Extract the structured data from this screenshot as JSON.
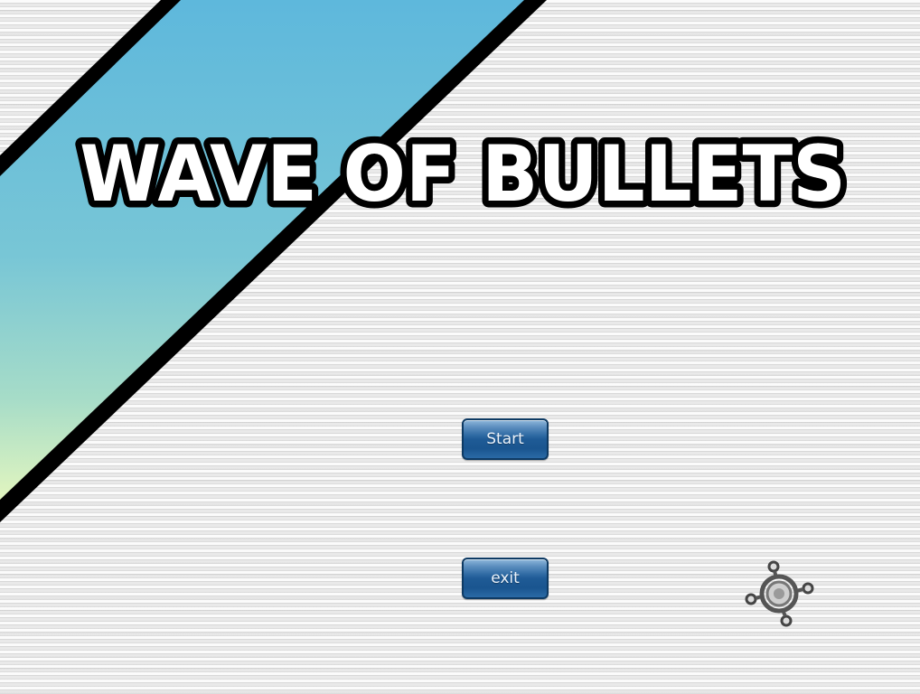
{
  "title": "WAVE OF BULLETS",
  "menu": {
    "start_label": "Start",
    "exit_label": "exit"
  },
  "colors": {
    "band_top": "#5eb8dc",
    "band_mid": "#7fcbd6",
    "band_bottom": "#e6f7c0",
    "band_outline": "#000000",
    "button_blue": "#1f5b96",
    "button_border": "#0e3a63",
    "title_fill": "#ffffff",
    "title_outline": "#000000"
  },
  "icons": {
    "player": "ship-crosshair-icon"
  }
}
